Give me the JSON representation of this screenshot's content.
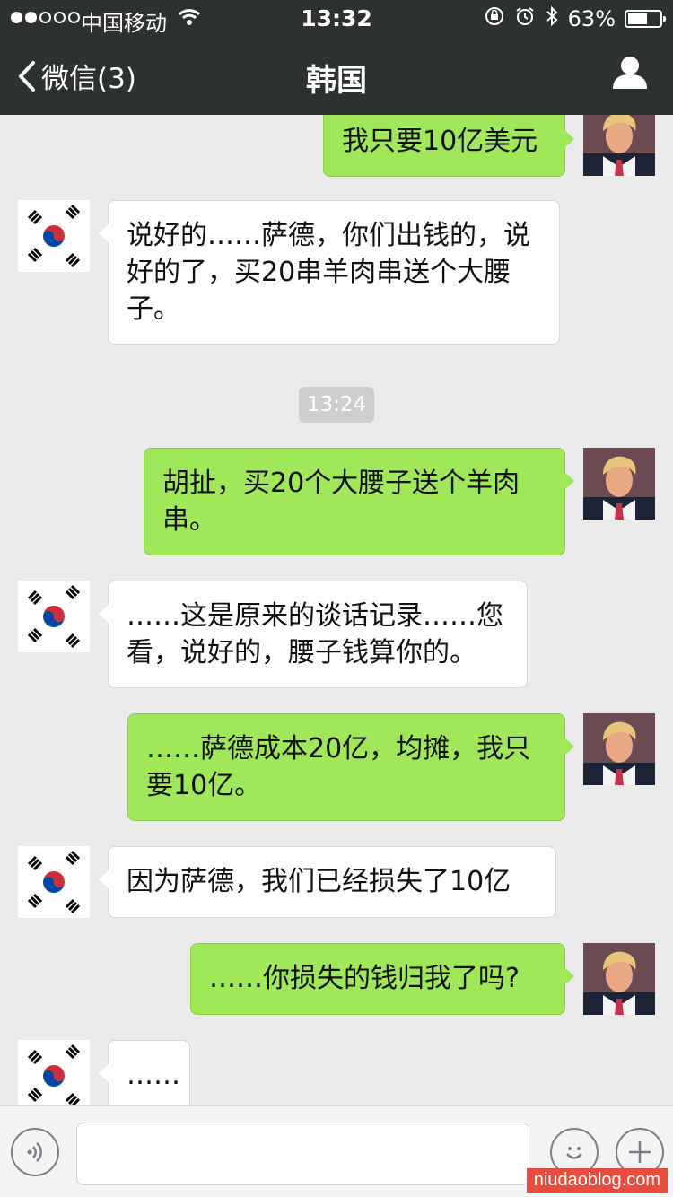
{
  "status_bar": {
    "carrier": "中国移动",
    "time": "13:32",
    "battery_text": "63%",
    "battery_level": 0.63
  },
  "nav": {
    "back_label": "微信(3)",
    "title": "韩国"
  },
  "messages": [
    {
      "side": "right",
      "text": "我只要10亿美元"
    },
    {
      "side": "left",
      "text": "说好的……萨德，你们出钱的，说好的了，买20串羊肉串送个大腰子。"
    },
    {
      "side": "right",
      "text": "胡扯，买20个大腰子送个羊肉串。"
    },
    {
      "side": "left",
      "text": "……这是原来的谈话记录……您看，说好的，腰子钱算你的。"
    },
    {
      "side": "right",
      "text": "……萨德成本20亿，均摊，我只要10亿。"
    },
    {
      "side": "left",
      "text": "因为萨德，我们已经损失了10亿"
    },
    {
      "side": "right",
      "text": "……你损失的钱归我了吗?"
    },
    {
      "side": "left",
      "text": "……"
    }
  ],
  "timestamp": "13:24",
  "input": {
    "value": "",
    "placeholder": ""
  },
  "watermark": "niudaoblog.com",
  "colors": {
    "nav_bg": "#2e3132",
    "chat_bg": "#ebebeb",
    "bubble_self": "#a0e75a",
    "bubble_other": "#ffffff"
  }
}
